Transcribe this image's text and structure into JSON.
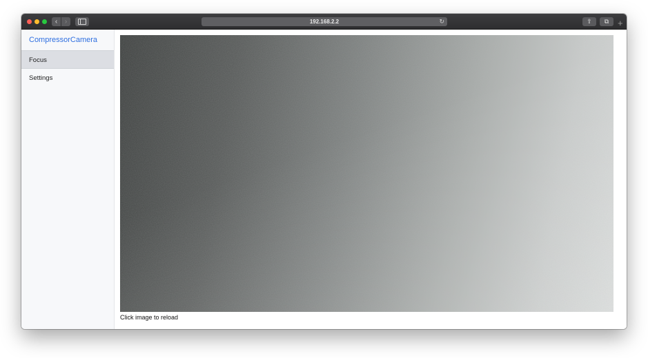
{
  "browser": {
    "url": "192.168.2.2",
    "back_icon": "‹",
    "forward_icon": "›",
    "reload_icon": "↻",
    "share_icon": "⇪",
    "tabs_icon": "⧉",
    "new_tab_icon": "+"
  },
  "sidebar": {
    "brand": "CompressorCamera",
    "items": [
      {
        "label": "Focus",
        "active": true
      },
      {
        "label": "Settings",
        "active": false
      }
    ]
  },
  "main": {
    "caption": "Click image to reload"
  },
  "colors": {
    "brand": "#2f6fe0",
    "sidebar_bg": "#f7f8fa",
    "active_item_bg": "#dcdee3"
  }
}
